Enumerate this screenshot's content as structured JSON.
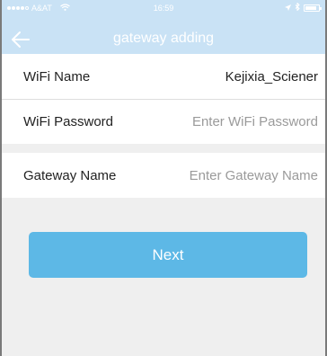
{
  "status_bar": {
    "carrier": "A&AT",
    "time": "16:59",
    "signal_filled": 4,
    "battery_fraction": 0.85
  },
  "nav": {
    "title": "gateway adding",
    "back_icon": "arrow-left-icon"
  },
  "form": {
    "wifi_name": {
      "label": "WiFi Name",
      "value": "Kejixia_Sciener"
    },
    "wifi_password": {
      "label": "WiFi Password",
      "placeholder": "Enter WiFi Password"
    },
    "gateway_name": {
      "label": "Gateway Name",
      "placeholder": "Enter Gateway Name"
    }
  },
  "actions": {
    "next_label": "Next"
  },
  "colors": {
    "header": "#c9e2f5",
    "accent": "#5db8e6",
    "background": "#efefef"
  }
}
